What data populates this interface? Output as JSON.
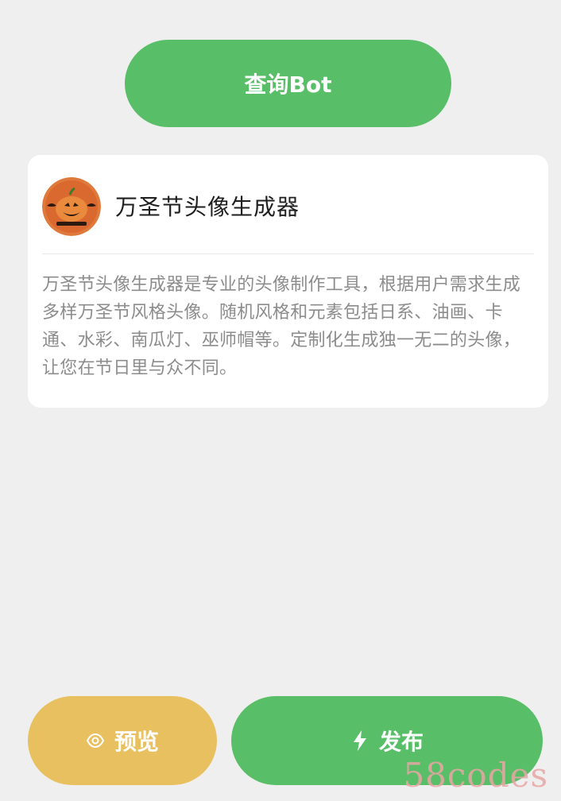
{
  "query_button": {
    "label": "查询Bot"
  },
  "bot_card": {
    "title": "万圣节头像生成器",
    "description": "万圣节头像生成器是专业的头像制作工具，根据用户需求生成多样万圣节风格头像。随机风格和元素包括日系、油画、卡通、水彩、南瓜灯、巫师帽等。定制化生成独一无二的头像，让您在节日里与众不同。",
    "avatar_icon": "halloween-pumpkin-avatar"
  },
  "actions": {
    "preview_label": "预览",
    "publish_label": "发布"
  },
  "watermark": "58codes",
  "colors": {
    "primary_green": "#58be68",
    "preview_yellow": "#e8c05f",
    "background": "#efefef"
  }
}
